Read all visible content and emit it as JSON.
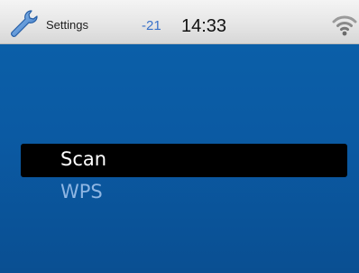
{
  "statusbar": {
    "app_icon": "wrench-icon",
    "title": "Settings",
    "signal_value": "-21",
    "time": "14:33",
    "wifi_icon": "wifi-icon"
  },
  "menu": {
    "items": [
      {
        "label": "Scan",
        "selected": true
      },
      {
        "label": "WPS",
        "selected": false
      }
    ]
  },
  "colors": {
    "background_blue": "#0b5aa3",
    "selection": "#000000",
    "signal_value_text": "#3a72c9",
    "unselected_item_text": "#8fb6e3"
  }
}
